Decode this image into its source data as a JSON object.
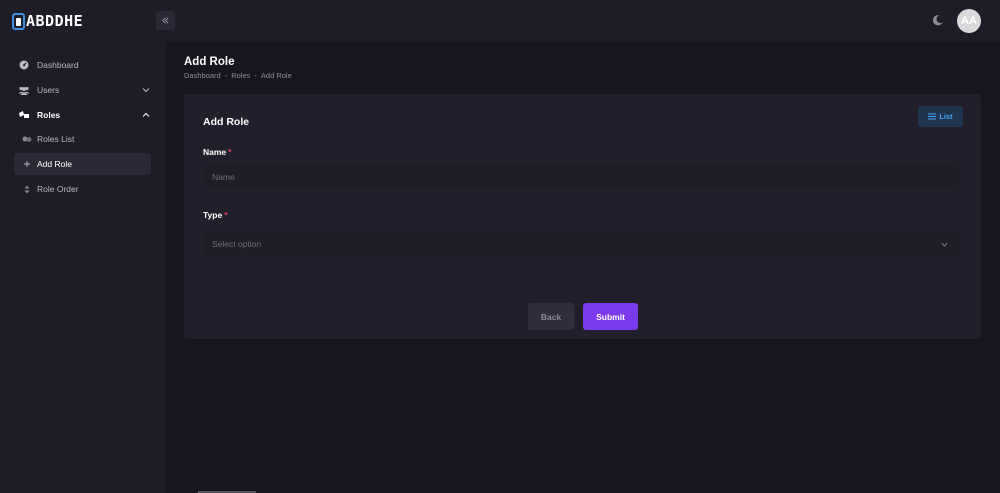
{
  "app": {
    "logo_text": "ABDDHE"
  },
  "header": {
    "avatar_initials": "AA"
  },
  "sidebar": {
    "items": [
      {
        "label": "Dashboard"
      },
      {
        "label": "Users"
      },
      {
        "label": "Roles"
      },
      {
        "label": "Roles List"
      },
      {
        "label": "Add Role"
      },
      {
        "label": "Role Order"
      }
    ]
  },
  "page": {
    "title": "Add Role",
    "breadcrumb": [
      "Dashboard",
      "Roles",
      "Add Role"
    ],
    "breadcrumb_separator": "-"
  },
  "form": {
    "card_title": "Add Role",
    "list_button": "List",
    "name_label": "Name",
    "name_placeholder": "Name",
    "type_label": "Type",
    "type_placeholder": "Select option",
    "required_mark": "*",
    "back_button": "Back",
    "submit_button": "Submit"
  },
  "colors": {
    "accent": "#7c3aed",
    "list_button_text": "#4aa3f0",
    "required": "#f0406a",
    "background": "#17161f",
    "panel": "#1d1c27"
  },
  "icons": [
    "double-chevron-left-icon",
    "moon-icon",
    "dashboard-icon",
    "users-icon",
    "roles-icon",
    "roles-list-icon",
    "plus-icon",
    "sort-icon",
    "chevron-down-icon",
    "chevron-up-icon",
    "list-icon"
  ]
}
